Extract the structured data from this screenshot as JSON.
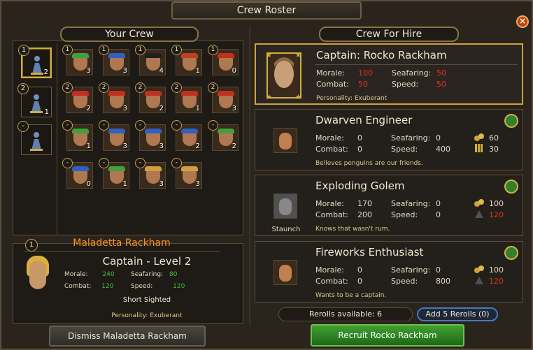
{
  "window": {
    "title": "Crew Roster"
  },
  "left": {
    "header": "Your Crew",
    "slots": [
      {
        "badge": "1",
        "count": "2"
      },
      {
        "badge": "2",
        "count": "1"
      },
      {
        "badge": "-",
        "count": ""
      }
    ],
    "crew": [
      {
        "lvl": "1",
        "num": "3",
        "band": "#40a040"
      },
      {
        "lvl": "1",
        "num": "3",
        "band": "#3060c0"
      },
      {
        "lvl": "1",
        "num": "4",
        "band": "#202020"
      },
      {
        "lvl": "1",
        "num": "1",
        "band": "#c04020"
      },
      {
        "lvl": "1",
        "num": "0",
        "band": "#c03020"
      },
      {
        "lvl": "2",
        "num": "2",
        "band": "#c03020"
      },
      {
        "lvl": "2",
        "num": "3",
        "band": "#c03020"
      },
      {
        "lvl": "2",
        "num": "2",
        "band": "#c03020"
      },
      {
        "lvl": "2",
        "num": "1",
        "band": "#c03020"
      },
      {
        "lvl": "2",
        "num": "3",
        "band": "#c03020"
      },
      {
        "lvl": "-",
        "num": "1",
        "band": "#40a040"
      },
      {
        "lvl": "-",
        "num": "3",
        "band": "#3060c0"
      },
      {
        "lvl": "-",
        "num": "3",
        "band": "#3060c0"
      },
      {
        "lvl": "-",
        "num": "2",
        "band": "#3060c0"
      },
      {
        "lvl": "-",
        "num": "2",
        "band": "#40a040"
      },
      {
        "lvl": "-",
        "num": "0",
        "band": "#3060c0"
      },
      {
        "lvl": "-",
        "num": "1",
        "band": "#40a040"
      },
      {
        "lvl": "-",
        "num": "3",
        "band": "#d0a040"
      },
      {
        "lvl": "-",
        "num": "3",
        "band": "#d0a040"
      }
    ]
  },
  "selected": {
    "badge": "1",
    "name": "Maladetta Rackham",
    "title": "Captain - Level 2",
    "morale_label": "Morale:",
    "morale": "240",
    "seafaring_label": "Seafaring:",
    "seafaring": "80",
    "combat_label": "Combat:",
    "combat": "120",
    "speed_label": "Speed:",
    "speed": "120",
    "trait": "Short Sighted",
    "personality": "Personality: Exuberant",
    "dismiss": "Dismiss Maladetta Rackham"
  },
  "right": {
    "header": "Crew For Hire",
    "cards": [
      {
        "name": "Captain: Rocko Rackham",
        "morale": "100",
        "seafaring": "50",
        "combat": "50",
        "speed": "50",
        "desc": "Personality: Exuberant"
      },
      {
        "name": "Dwarven Engineer",
        "morale": "0",
        "seafaring": "0",
        "combat": "0",
        "speed": "400",
        "cost1": "60",
        "cost2": "30",
        "desc": "Believes penguins are our friends."
      },
      {
        "name": "Exploding Golem",
        "sublabel": "Staunch",
        "morale": "170",
        "seafaring": "0",
        "combat": "200",
        "speed": "0",
        "cost1": "100",
        "cost2": "120",
        "desc": "Knows that wasn't rum."
      },
      {
        "name": "Fireworks Enthusiast",
        "morale": "0",
        "seafaring": "0",
        "combat": "0",
        "speed": "800",
        "cost1": "100",
        "cost2": "120",
        "desc": "Wants to be a captain."
      }
    ],
    "labels": {
      "morale": "Morale:",
      "seafaring": "Seafaring:",
      "combat": "Combat:",
      "speed": "Speed:"
    },
    "rerolls": "Rerolls available: 6",
    "add_rerolls": "Add 5 Rerolls (0)",
    "recruit": "Recruit Rocko Rackham"
  },
  "colors": {
    "accent_gold": "#d0a040",
    "stat_green": "#40c040",
    "stat_red": "#e03020",
    "name_orange": "#ff9020"
  }
}
